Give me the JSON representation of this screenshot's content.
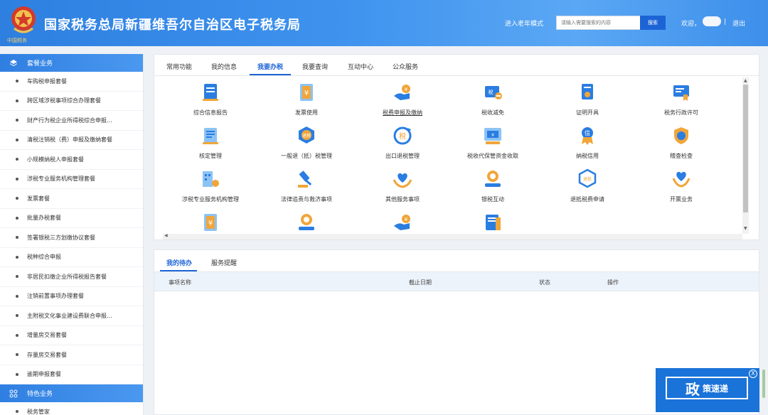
{
  "header": {
    "emblem_text": "中国税务",
    "title": "国家税务总局新疆维吾尔自治区电子税务局",
    "elder_mode": "进入老年模式",
    "search_placeholder": "请输入需要搜索的内容",
    "search_button": "搜索",
    "welcome": "欢迎，",
    "separator": "|",
    "logout": "退出"
  },
  "sidebar": {
    "section1": "套餐业务",
    "items": [
      "车购税申报套餐",
      "跨区域涉税事项综合办理套餐",
      "财产行为税企业所得税综合申报...",
      "清税注销税（费）申报及缴纳套餐",
      "小规模纳税人申报套餐",
      "涉税专业服务机构管理套餐",
      "发票套餐",
      "批量办税套餐",
      "签署银税三方划缴协议套餐",
      "税种综合申报",
      "非居民扣缴企业所得税报告套餐",
      "注销前置事项办理套餐",
      "主附税文化事业建设费联合申报...",
      "增量房交易套餐",
      "存量房交易套餐",
      "逾期申报套餐"
    ],
    "section2": "特色业务",
    "section2_items": [
      "税务管家"
    ]
  },
  "main_tabs": [
    "常用功能",
    "我的信息",
    "我要办税",
    "我要查询",
    "互动中心",
    "公众服务"
  ],
  "active_tab": "我要办税",
  "functions": [
    {
      "label": "综合信息报告",
      "icon": "report-icon"
    },
    {
      "label": "发票使用",
      "icon": "invoice-icon"
    },
    {
      "label": "税费申报及缴纳",
      "icon": "tax-payment-icon"
    },
    {
      "label": "税收减免",
      "icon": "tax-relief-icon"
    },
    {
      "label": "证明开具",
      "icon": "certificate-icon"
    },
    {
      "label": "税务行政许可",
      "icon": "permit-icon"
    },
    {
      "label": "核定管理",
      "icon": "assessment-icon"
    },
    {
      "label": "一般退（抵）税管理",
      "icon": "refund-icon"
    },
    {
      "label": "出口退税管理",
      "icon": "export-refund-icon"
    },
    {
      "label": "税收代保管资金收取",
      "icon": "custody-fund-icon"
    },
    {
      "label": "纳税信用",
      "icon": "credit-icon"
    },
    {
      "label": "稽查检查",
      "icon": "inspection-icon"
    },
    {
      "label": "涉税专业服务机构管理",
      "icon": "agency-icon"
    },
    {
      "label": "法律追责与救济事项",
      "icon": "gavel-icon"
    },
    {
      "label": "其他服务事项",
      "icon": "heart-hands-icon"
    },
    {
      "label": "银税互动",
      "icon": "bank-tax-icon"
    },
    {
      "label": "退抵税费申请",
      "icon": "refund-apply-icon"
    },
    {
      "label": "开票业务",
      "icon": "billing-icon"
    },
    {
      "label": "",
      "icon": "invoice-icon"
    },
    {
      "label": "",
      "icon": "bank-tax-icon"
    },
    {
      "label": "",
      "icon": "tax-payment-icon"
    },
    {
      "label": "",
      "icon": "document-icon"
    }
  ],
  "bottom_tabs": [
    "我的待办",
    "服务提醒"
  ],
  "table_headers": [
    "事项名称",
    "截止日期",
    "状态",
    "操作"
  ],
  "badge": {
    "big": "政",
    "small": "策速递",
    "close": "X"
  },
  "colors": {
    "primary": "#1c64d6",
    "header": "#3f93ee",
    "icon_blue": "#2a7de1",
    "icon_gold": "#f0a63a"
  }
}
